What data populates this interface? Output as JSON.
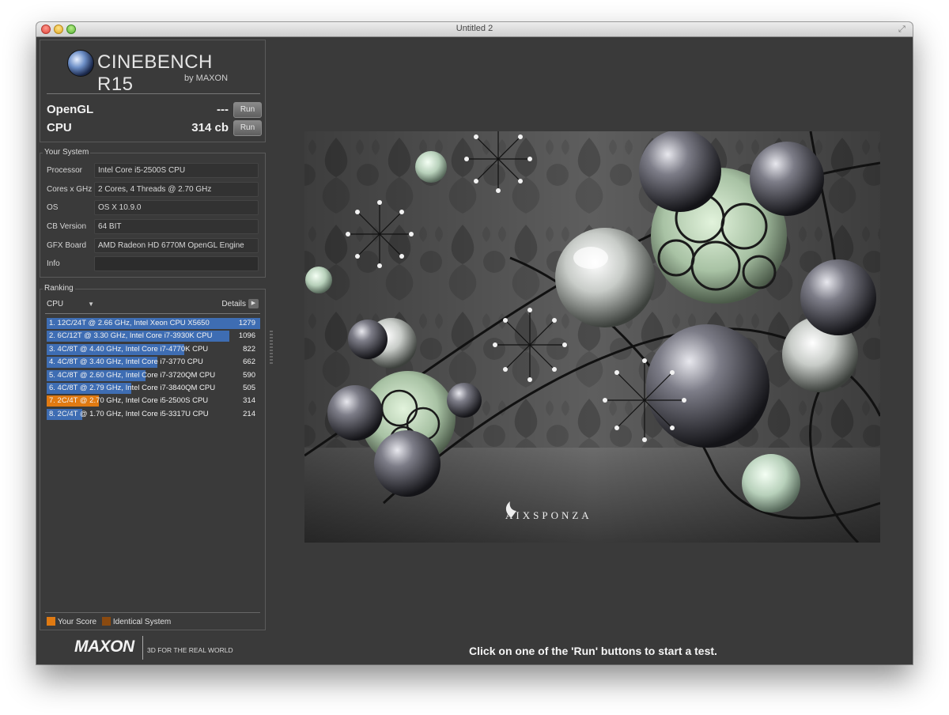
{
  "window": {
    "title": "Untitled 2"
  },
  "logo": {
    "name": "CINEBENCH R15",
    "byline": "by MAXON"
  },
  "scores": [
    {
      "label": "OpenGL",
      "value": "---",
      "button": "Run"
    },
    {
      "label": "CPU",
      "value": "314 cb",
      "button": "Run"
    }
  ],
  "your_system": {
    "title": "Your System",
    "rows": [
      {
        "key": "Processor",
        "value": "Intel Core i5-2500S CPU"
      },
      {
        "key": "Cores x GHz",
        "value": "2 Cores, 4 Threads @ 2.70 GHz"
      },
      {
        "key": "OS",
        "value": "OS X 10.9.0"
      },
      {
        "key": "CB Version",
        "value": "64 BIT"
      },
      {
        "key": "GFX Board",
        "value": "AMD Radeon HD 6770M OpenGL Engine"
      },
      {
        "key": "Info",
        "value": ""
      }
    ]
  },
  "ranking": {
    "title": "Ranking",
    "selected_test": "CPU",
    "details_label": "Details",
    "rows": [
      {
        "label": "1. 12C/24T @ 2.66 GHz, Intel Xeon CPU X5650",
        "score": "1279",
        "value": 1279,
        "color": "#3e6db3"
      },
      {
        "label": "2. 6C/12T @ 3.30 GHz,  Intel Core i7-3930K CPU",
        "score": "1096",
        "value": 1096,
        "color": "#3e6db3"
      },
      {
        "label": "3. 4C/8T @ 4.40 GHz, Intel Core i7-4770K CPU",
        "score": "822",
        "value": 822,
        "color": "#3e6db3"
      },
      {
        "label": "4. 4C/8T @ 3.40 GHz,  Intel Core i7-3770 CPU",
        "score": "662",
        "value": 662,
        "color": "#3e6db3"
      },
      {
        "label": "5. 4C/8T @ 2.60 GHz, Intel Core i7-3720QM CPU",
        "score": "590",
        "value": 590,
        "color": "#3e6db3"
      },
      {
        "label": "6. 4C/8T @ 2.79 GHz, Intel Core i7-3840QM CPU",
        "score": "505",
        "value": 505,
        "color": "#3e6db3"
      },
      {
        "label": "7. 2C/4T @ 2.70 GHz, Intel Core i5-2500S CPU",
        "score": "314",
        "value": 314,
        "color": "#e07a12"
      },
      {
        "label": "8. 2C/4T @ 1.70 GHz,  Intel Core i5-3317U CPU",
        "score": "214",
        "value": 214,
        "color": "#3e6db3"
      }
    ],
    "max_value": 1279,
    "legend": [
      {
        "label": "Your Score",
        "color": "#e07a12"
      },
      {
        "label": "Identical System",
        "color": "#8a4a10"
      }
    ]
  },
  "footer": {
    "maxon": "MAXON",
    "tagline": "3D FOR THE REAL WORLD",
    "status": "Click on one of the 'Run' buttons to start a test."
  },
  "render": {
    "brand": "AIXSPONZA"
  }
}
